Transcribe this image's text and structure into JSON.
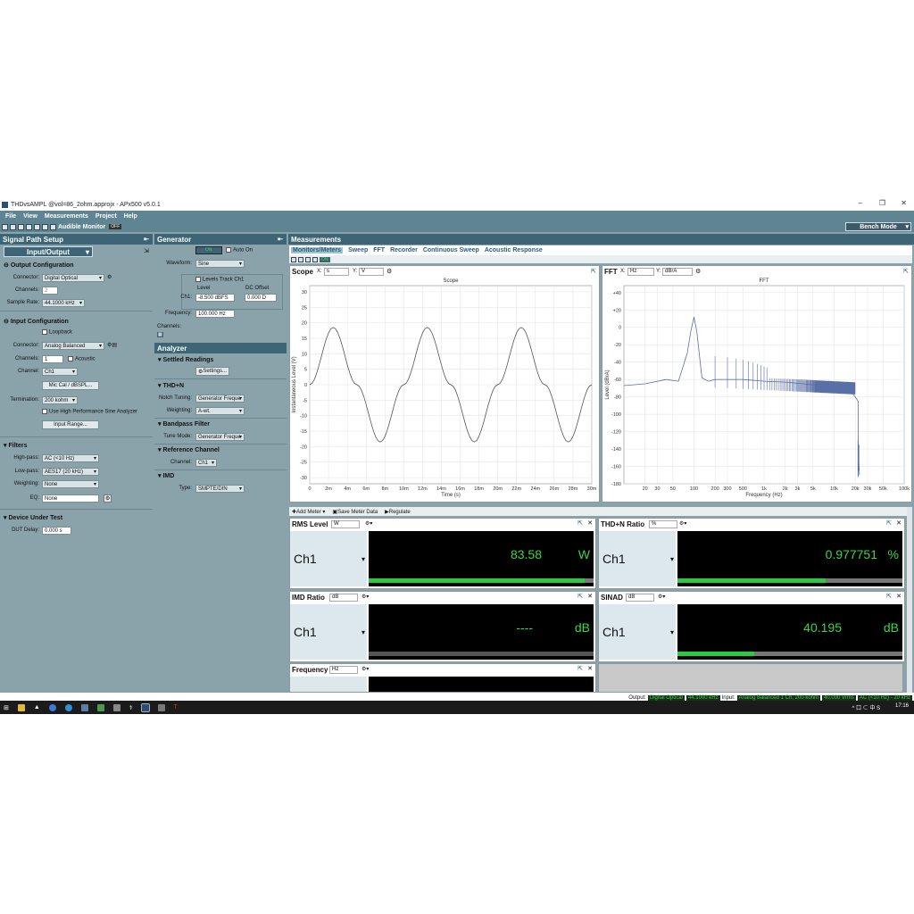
{
  "window": {
    "title": "THDvsAMPL @vol=86_2ohm.approjx - APx500 v5.0.1",
    "controls": [
      "–",
      "❐",
      "✕"
    ]
  },
  "menu": [
    "File",
    "View",
    "Measurements",
    "Project",
    "Help"
  ],
  "toolbar": {
    "audible_monitor": "Audible Monitor",
    "audible_monitor_state": "OFF",
    "bench_mode": "Bench Mode"
  },
  "signal_path": {
    "header": "Signal Path Setup",
    "dropdown": "Input/Output",
    "output_config": {
      "title": "Output Configuration",
      "connector_label": "Connector:",
      "connector": "Digital Optical",
      "channels_label": "Channels:",
      "channels": "2",
      "sample_rate_label": "Sample Rate:",
      "sample_rate": "44.1000 kHz"
    },
    "input_config": {
      "title": "Input Configuration",
      "loopback": "Loopback",
      "connector_label": "Connector:",
      "connector": "Analog Balanced",
      "channels_label": "Channels:",
      "channels": "1",
      "acoustic": "Acoustic",
      "channel_label": "Channel:",
      "channel": "Ch1",
      "mic_cal_button": "Mic Cal / dBSPL...",
      "termination_label": "Termination:",
      "termination": "200 kohm",
      "high_perf": "Use High Performance Sine Analyzer",
      "input_range_button": "Input Range..."
    },
    "filters": {
      "title": "Filters",
      "highpass_label": "High-pass:",
      "highpass": "AC (<10 Hz)",
      "lowpass_label": "Low-pass:",
      "lowpass": "AES17 (20 kHz)",
      "weighting_label": "Weighting:",
      "weighting": "None",
      "eq_label": "EQ:",
      "eq": "None"
    },
    "dut": {
      "title": "Device Under Test",
      "delay_label": "DUT Delay:",
      "delay": "0.000 s"
    }
  },
  "generator": {
    "header": "Generator",
    "on_label": "ON",
    "auto_on": "Auto On",
    "waveform_label": "Waveform:",
    "waveform": "Sine",
    "levels_track": "Levels Track Ch1",
    "level_header": "Level",
    "dc_offset_header": "DC Offset",
    "ch1_label": "Ch1:",
    "level": "-8.500 dBFS",
    "dc_offset": "0.000 D",
    "frequency_label": "Frequency:",
    "frequency": "100.000 Hz",
    "channels_label": "Channels:"
  },
  "analyzer": {
    "header": "Analyzer",
    "settled_readings": "Settled Readings",
    "settings_button": "Settings...",
    "thdn": "THD+N",
    "notch_label": "Notch Tuning:",
    "notch": "Generator Freque",
    "weighting_label": "Weighting:",
    "weighting": "A-wt.",
    "bandpass": "Bandpass Filter",
    "tune_label": "Tune Mode:",
    "tune": "Generator Freque",
    "ref_channel": "Reference Channel",
    "channel_label": "Channel:",
    "channel": "Ch1",
    "imd": "IMD",
    "type_label": "Type:",
    "type": "SMPTE/DIN"
  },
  "measurements": {
    "header": "Measurements",
    "tabs": [
      "Monitors/Meters",
      "Sweep",
      "FFT",
      "Recorder",
      "Continuous Sweep",
      "Acoustic Response"
    ],
    "on_label": "ON"
  },
  "scope": {
    "label": "Scope",
    "x_label": "X:",
    "x_unit": "s",
    "y_label": "Y:",
    "y_unit": "V",
    "title": "Scope",
    "xlabel": "Time (s)",
    "ylabel": "Instantaneous Level (V)",
    "x_ticks": [
      "0",
      "2m",
      "4m",
      "6m",
      "8m",
      "10m",
      "12m",
      "14m",
      "16m",
      "18m",
      "20m",
      "22m",
      "24m",
      "26m",
      "28m",
      "30m"
    ],
    "y_ticks": [
      "30",
      "25",
      "20",
      "15",
      "10",
      "5",
      "0",
      "-5",
      "-10",
      "-15",
      "-20",
      "-25",
      "-30"
    ]
  },
  "fft": {
    "label": "FFT",
    "x_label": "X:",
    "x_unit": "Hz",
    "y_label": "Y:",
    "y_unit": "dBrA",
    "title": "FFT",
    "xlabel": "Frequency (Hz)",
    "ylabel": "Level (dBrA)",
    "x_ticks": [
      "20",
      "30",
      "50",
      "100",
      "200",
      "300",
      "500",
      "1k",
      "2k",
      "3k",
      "5k",
      "10k",
      "20k",
      "30k",
      "50k",
      "100k"
    ],
    "y_ticks": [
      "+40",
      "+20",
      "0",
      "-20",
      "-40",
      "-60",
      "-80",
      "-100",
      "-120",
      "-140",
      "-160",
      "-180"
    ]
  },
  "chart_data": [
    {
      "type": "line",
      "title": "Scope",
      "xlabel": "Time (s)",
      "ylabel": "Instantaneous Level (V)",
      "xlim": [
        0,
        0.03
      ],
      "ylim": [
        -32,
        32
      ],
      "series": [
        {
          "x": [
            0,
            0.0025,
            0.005,
            0.0075,
            0.01,
            0.0125,
            0.015,
            0.0175,
            0.02,
            0.0225,
            0.025,
            0.0275,
            0.03
          ],
          "y": [
            0,
            18.5,
            0,
            -18.5,
            0,
            18.5,
            0,
            -18.5,
            0,
            18.5,
            0,
            -18.5,
            0
          ]
        }
      ],
      "grid": true
    },
    {
      "type": "line",
      "title": "FFT",
      "xlabel": "Frequency (Hz)",
      "ylabel": "Level (dBrA)",
      "xlim": [
        10,
        100000
      ],
      "ylim": [
        -180,
        48
      ],
      "x_scale": "log",
      "series": [
        {
          "x": [
            10,
            20,
            40,
            60,
            80,
            90,
            100,
            110,
            130,
            160,
            200,
            300,
            500,
            1000,
            2000,
            5000,
            10000,
            15000,
            20000,
            22000,
            22000,
            23000
          ],
          "y": [
            -67,
            -65,
            -60,
            -62,
            -30,
            -5,
            12,
            -5,
            -58,
            -62,
            -60,
            -60,
            -60,
            -62,
            -63,
            -66,
            -67,
            -67,
            -80,
            -85,
            -140,
            -170
          ]
        }
      ],
      "grid": true
    }
  ],
  "meter_bar": {
    "add_meter": "Add Meter",
    "save_meter": "Save Meter Data",
    "regulate": "Regulate"
  },
  "meters": [
    {
      "name": "RMS Level",
      "unit_select": "W",
      "channel": "Ch1",
      "value": "83.58",
      "unit": "W",
      "fill": 0.96
    },
    {
      "name": "THD+N Ratio",
      "unit_select": "%",
      "channel": "Ch1",
      "value": "0.977751",
      "unit": "%",
      "fill": 0.66
    },
    {
      "name": "IMD Ratio",
      "unit_select": "dB",
      "channel": "Ch1",
      "value": "----",
      "unit": "dB",
      "fill": 0
    },
    {
      "name": "SINAD",
      "unit_select": "dB",
      "channel": "Ch1",
      "value": "40.195",
      "unit": "dB",
      "fill": 0.34
    },
    {
      "name": "Frequency",
      "unit_select": "Hz"
    }
  ],
  "status": {
    "output_label": "Output:",
    "output": "Digital Optical",
    "output_rate": "44.1000 kHz",
    "input_label": "Input:",
    "input": "Analog Balanced 1 Ch, 200 kohm",
    "input_range": "40.000 Vrms",
    "input_filter": "AC (<10 Hz) - 20 kHz"
  },
  "taskbar": {
    "tray": "^ 口 ⊂ 中 S",
    "time": "17:16"
  },
  "colors": {
    "panel": "#8aa3ab",
    "header": "#3e6576",
    "meter_green": "#38d74a",
    "trace": "#5a6fa5"
  }
}
